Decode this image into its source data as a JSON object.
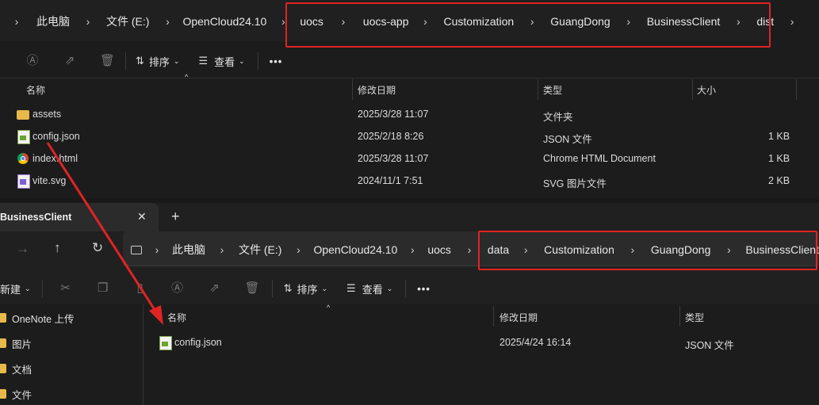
{
  "window1": {
    "breadcrumb": [
      "此电脑",
      "文件 (E:)",
      "OpenCloud24.10",
      "uocs",
      "uocs-app",
      "Customization",
      "GuangDong",
      "BusinessClient",
      "dist"
    ],
    "toolbar": {
      "sort_label": "排序",
      "view_label": "查看",
      "more_label": "•••"
    },
    "columns": {
      "name": "名称",
      "date": "修改日期",
      "type": "类型",
      "size": "大小"
    },
    "files": [
      {
        "name": "assets",
        "date": "2025/3/28 11:07",
        "type": "文件夹",
        "size": "",
        "icon": "folder-icon"
      },
      {
        "name": "config.json",
        "date": "2025/2/18 8:26",
        "type": "JSON 文件",
        "size": "1 KB",
        "icon": "json-file-icon"
      },
      {
        "name": "index.html",
        "date": "2025/3/28 11:07",
        "type": "Chrome HTML Document",
        "size": "1 KB",
        "icon": "chrome-html-icon"
      },
      {
        "name": "vite.svg",
        "date": "2024/11/1 7:51",
        "type": "SVG 图片文件",
        "size": "2 KB",
        "icon": "svg-file-icon"
      }
    ]
  },
  "window2": {
    "tab_title": "BusinessClient",
    "tab_close": "✕",
    "tab_add": "+",
    "breadcrumb": [
      "此电脑",
      "文件 (E:)",
      "OpenCloud24.10",
      "uocs",
      "data",
      "Customization",
      "GuangDong",
      "BusinessClient"
    ],
    "toolbar": {
      "new_label": "新建",
      "sort_label": "排序",
      "view_label": "查看",
      "more_label": "•••"
    },
    "nav_items": [
      "OneNote 上传",
      "图片",
      "文档",
      "文件"
    ],
    "columns": {
      "name": "名称",
      "date": "修改日期",
      "type": "类型"
    },
    "files": [
      {
        "name": "config.json",
        "date": "2025/4/24 16:14",
        "type": "JSON 文件",
        "icon": "json-file-icon"
      }
    ]
  },
  "colors": {
    "highlight_box": "#e02424",
    "arrow": "#e02424"
  }
}
